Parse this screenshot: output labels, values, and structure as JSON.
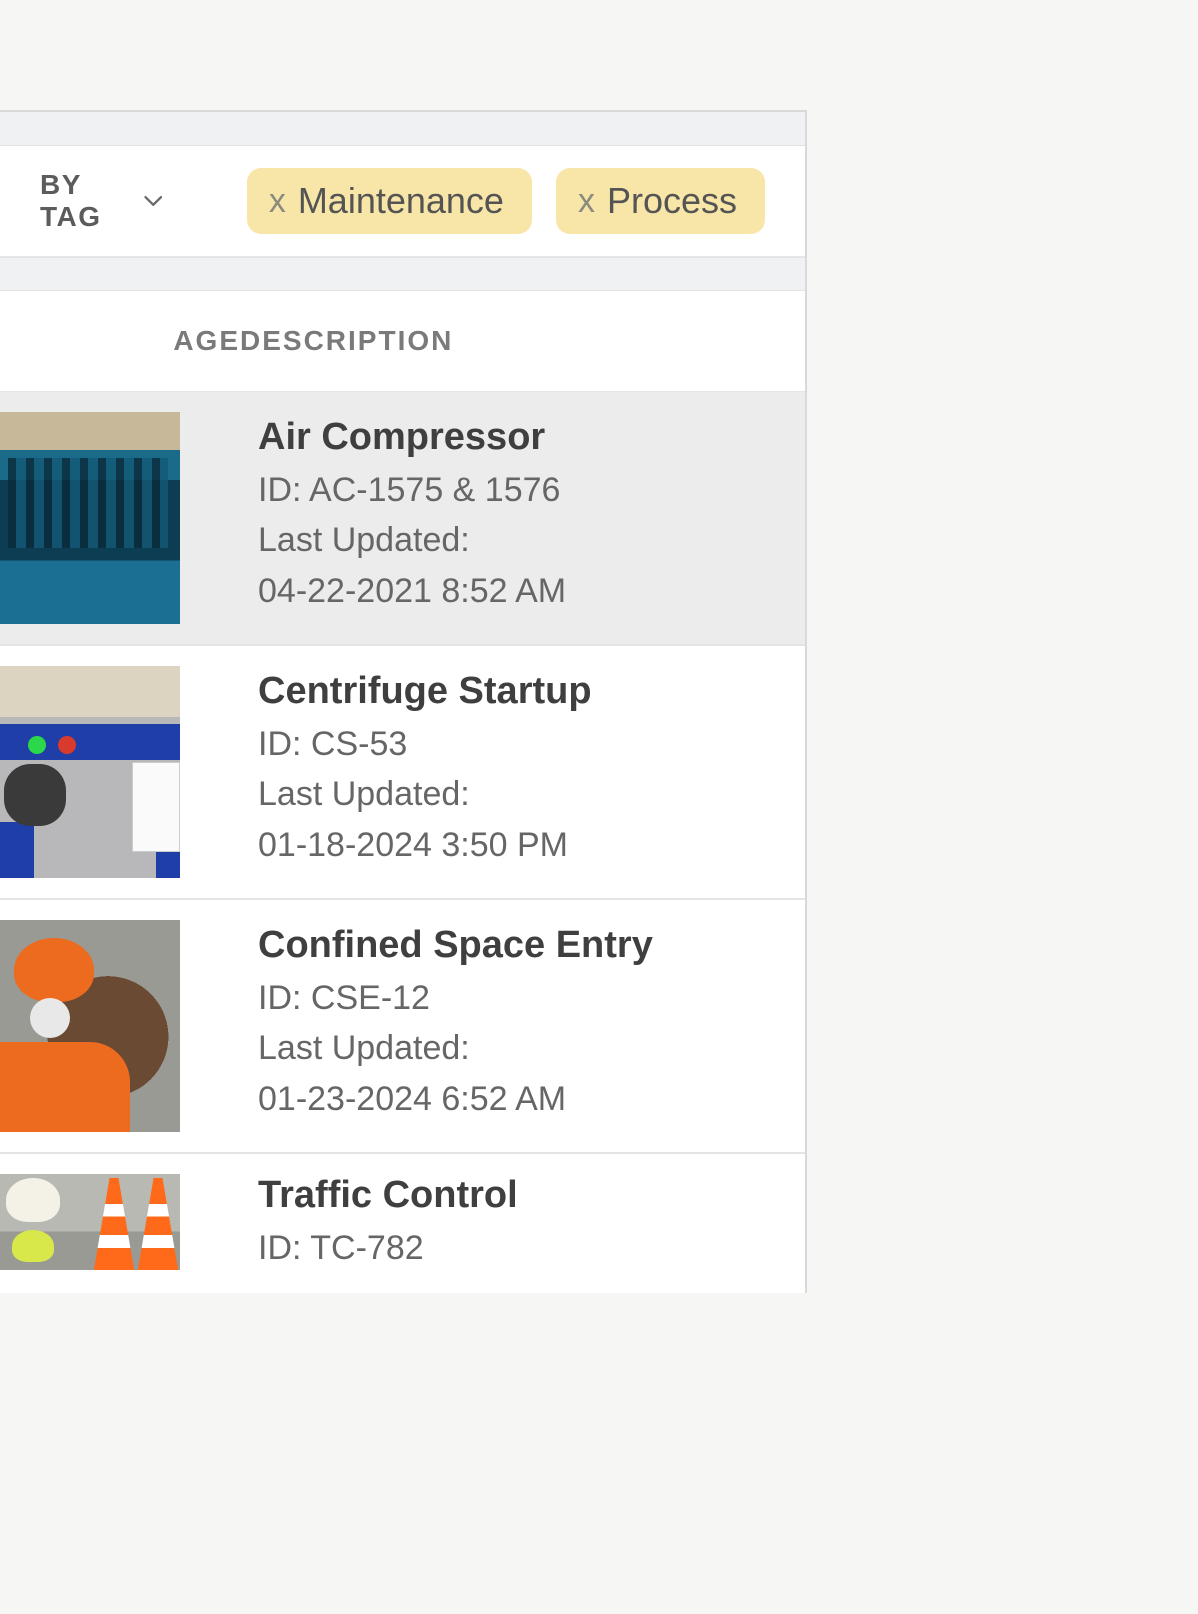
{
  "filter": {
    "dropdown_label": "BY TAG",
    "chips": [
      {
        "label": "Maintenance"
      },
      {
        "label": "Process"
      }
    ]
  },
  "columns": {
    "image": "IMAGE",
    "image_visible_fragment": "AGE",
    "description": "DESCRIPTION"
  },
  "labels": {
    "id_prefix": "ID: ",
    "updated_prefix": "Last Updated:"
  },
  "items": [
    {
      "title": "Air Compressor",
      "id": "AC-1575 & 1576",
      "updated": "04-22-2021 8:52 AM",
      "selected": true,
      "thumb": "compressor"
    },
    {
      "title": "Centrifuge Startup",
      "id": "CS-53",
      "updated": "01-18-2024 3:50 PM",
      "selected": false,
      "thumb": "centrifuge"
    },
    {
      "title": "Confined Space Entry",
      "id": "CSE-12",
      "updated": "01-23-2024 6:52 AM",
      "selected": false,
      "thumb": "confined"
    },
    {
      "title": "Traffic Control",
      "id": "TC-782",
      "updated": "",
      "selected": false,
      "thumb": "traffic"
    }
  ]
}
